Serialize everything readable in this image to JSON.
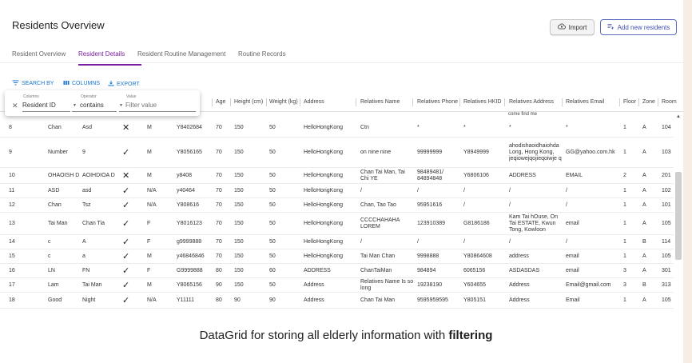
{
  "page_title": "Residents Overview",
  "buttons": {
    "import_label": "Import",
    "add_label": "Add new residents"
  },
  "tabs": [
    "Resident Overview",
    "Resident Details",
    "Resident Routine Management",
    "Routine Records"
  ],
  "active_tab": "Resident Details",
  "toolbar": {
    "search_by": "SEARCH BY",
    "columns": "COLUMNS",
    "export": "EXPORT"
  },
  "filter": {
    "columns_label": "Columns",
    "operator_label": "Operator",
    "value_label": "Value",
    "column_value": "Resident ID",
    "operator_value": "contains",
    "value_placeholder": "Filter value"
  },
  "columns": [
    "Age",
    "Height (cm)",
    "Weight (kg)",
    "Address",
    "Relatives Name",
    "Relatives Phone",
    "Relatives HKID",
    "Relatives Address",
    "Relatives Email",
    "Floor",
    "Zone",
    "Room"
  ],
  "partial_text_above": "come find me",
  "rows": [
    [
      "8",
      "Chan",
      "Asd",
      "✕",
      "M",
      "Y8402684",
      "70",
      "150",
      "50",
      "HelloHongKong",
      "Ctn",
      "*",
      "*",
      "*",
      "*",
      "1",
      "A",
      "104"
    ],
    [
      "9",
      "Number",
      "9",
      "✓",
      "M",
      "Y8056165",
      "70",
      "150",
      "50",
      "HelloHongKong",
      "on nine nine",
      "99999999",
      "Y8949999",
      "ahodishaoidhaiohda Long, Hong Kong, jeqiowejqojieqoiwje q",
      "GG@yahoo.com.hk",
      "1",
      "A",
      "103"
    ],
    [
      "10",
      "OHAOISH D",
      "AOIHDIOA D",
      "✕",
      "M",
      "y8408",
      "70",
      "150",
      "50",
      "HelloHongKong",
      "Chan Tai Man, Tai Chi YE",
      "98489481/ 84894848",
      "Y6806106",
      "ADDRESS",
      "EMAIL",
      "2",
      "A",
      "201"
    ],
    [
      "11",
      "ASD",
      "asd",
      "✓",
      "N/A",
      "y40464",
      "70",
      "150",
      "50",
      "HelloHongKong",
      "/",
      "/",
      "/",
      "/",
      "/",
      "1",
      "A",
      "102"
    ],
    [
      "12",
      "Chan",
      "Tsz",
      "✓",
      "N/A",
      "Y808616",
      "70",
      "150",
      "50",
      "HelloHongKong",
      "Chan, Tao Tao",
      "95951616",
      "/",
      "/",
      "/",
      "1",
      "A",
      "101"
    ],
    [
      "13",
      "Tai Man",
      "Chan Tia",
      "✓",
      "F",
      "Y8016123",
      "70",
      "150",
      "50",
      "HelloHongKong",
      "CCCCHAHAHA LOREM",
      "123910389",
      "G8186186",
      "Kam Tai hOuse, On Tai ESTATE, Kwun Tong, Kowloon",
      "email",
      "1",
      "A",
      "105"
    ],
    [
      "14",
      "c",
      "A",
      "✓",
      "F",
      "g9999888",
      "70",
      "150",
      "50",
      "HelloHongKong",
      "/",
      "/",
      "/",
      "/",
      "/",
      "1",
      "B",
      "114"
    ],
    [
      "15",
      "c",
      "a",
      "✓",
      "M",
      "y46846846",
      "70",
      "150",
      "50",
      "HelloHongKong",
      "Tai Man Chan",
      "9998888",
      "Y80864608",
      "address",
      "email",
      "1",
      "A",
      "105"
    ],
    [
      "16",
      "LN",
      "FN",
      "✓",
      "F",
      "G9999888",
      "80",
      "150",
      "60",
      "ADDRESS",
      "ChanTaiMan",
      "984894",
      "6065156",
      "ASDASDAS",
      "email",
      "3",
      "A",
      "301"
    ],
    [
      "17",
      "Lam",
      "Tai Man",
      "✓",
      "M",
      "Y8065156",
      "90",
      "150",
      "50",
      "Address",
      "Relatives Name Is so long",
      "19238190",
      "Y604655",
      "Address",
      "Email@gmail.com",
      "3",
      "B",
      "313"
    ],
    [
      "18",
      "Good",
      "Night",
      "✓",
      "N/A",
      "Y11111",
      "80",
      "90",
      "90",
      "Address",
      "Chan Tai Man",
      "9595959595",
      "Y805151",
      "Address",
      "Email",
      "1",
      "A",
      "105"
    ]
  ],
  "caption": {
    "text": "DataGrid for storing all elderly information with ",
    "bold": "filtering"
  }
}
